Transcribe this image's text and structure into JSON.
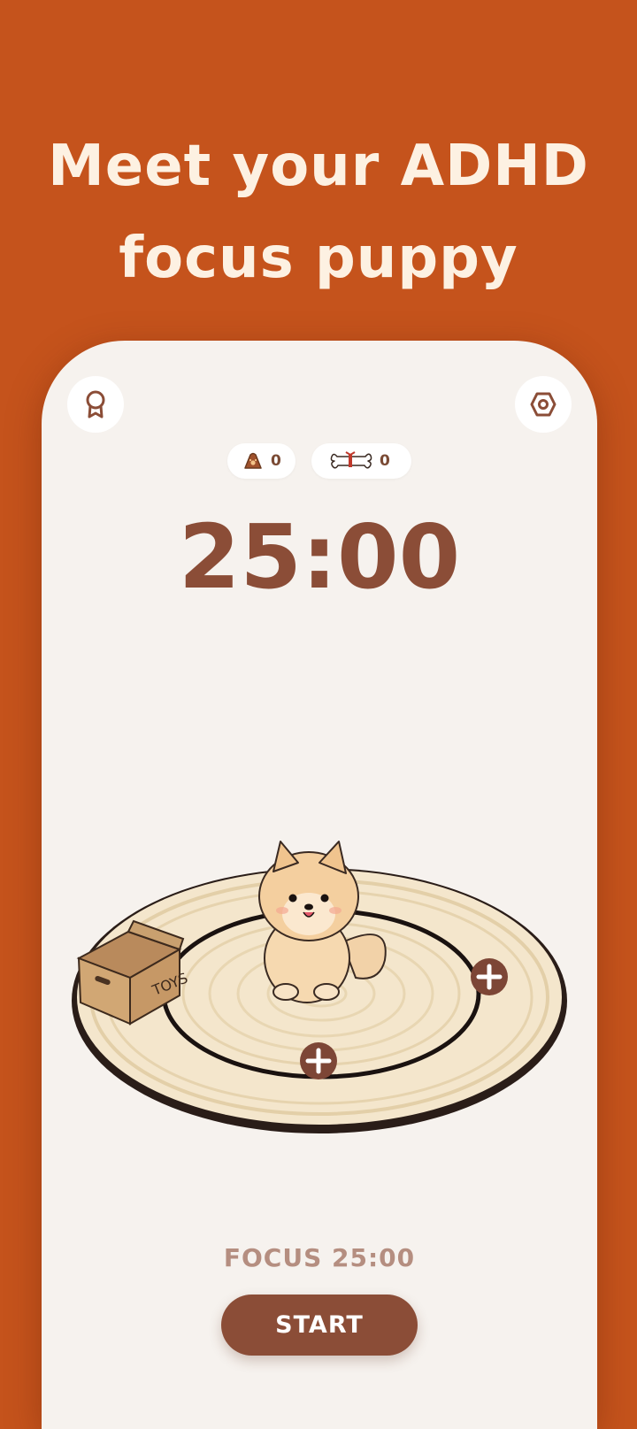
{
  "headline": {
    "line1": "Meet your ADHD",
    "line2": "focus puppy"
  },
  "top_bar": {
    "left_icon": "award-ribbon-icon",
    "right_icon": "settings-hexagon-icon"
  },
  "counters": {
    "food": {
      "icon": "food-bag-icon",
      "value": "0"
    },
    "treat": {
      "icon": "bone-icon",
      "value": "0"
    }
  },
  "timer": {
    "display": "25:00"
  },
  "scene": {
    "box_label": "TOYS",
    "add_buttons": [
      "plus-circle-icon",
      "plus-circle-icon"
    ]
  },
  "session": {
    "label": "FOCUS 25:00",
    "start_label": "START"
  },
  "colors": {
    "background": "#c5531c",
    "headline_text": "#fdf1e2",
    "card": "#f6f2ee",
    "accent_brown": "#8b4d37",
    "muted_label": "#b58e80"
  }
}
